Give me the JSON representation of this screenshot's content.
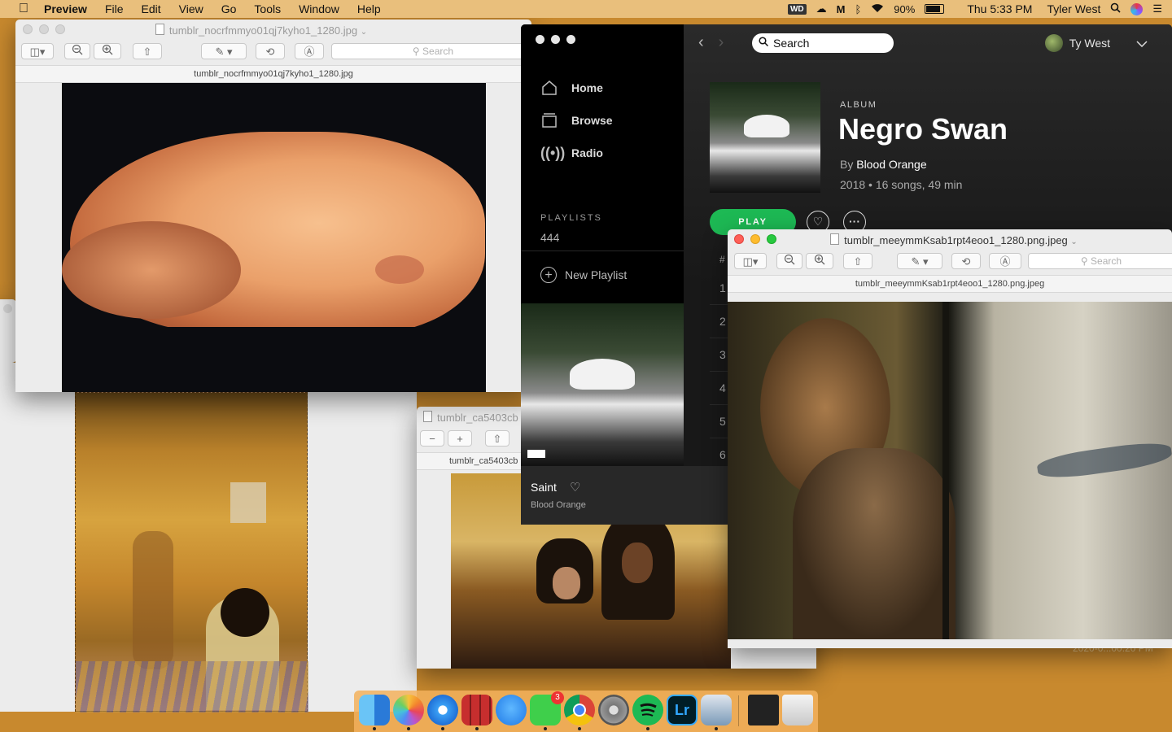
{
  "menubar": {
    "app": "Preview",
    "items": [
      "File",
      "Edit",
      "View",
      "Go",
      "Tools",
      "Window",
      "Help"
    ],
    "battery": "90%",
    "battery_level": 0.9,
    "clock": "Thu 5:33 PM",
    "user": "Tyler West",
    "status_icons": [
      "wd-icon",
      "creative-cloud-icon",
      "m-icon",
      "bluetooth-icon",
      "wifi-icon",
      "battery-icon",
      "search-icon",
      "siri-icon",
      "list-icon"
    ]
  },
  "preview1": {
    "title": "tumblr_nocrfmmyo01qj7kyho1_1280.jpg",
    "filename": "tumblr_nocrfmmyo01qj7kyho1_1280.jpg",
    "search_placeholder": "Search"
  },
  "preview2": {
    "title": "tumblr_ca5403cb",
    "filename": "tumblr_ca5403cb"
  },
  "preview3": {
    "title": "tumblr_meeymmKsab1rpt4eoo1_1280.png.jpeg",
    "filename": "tumblr_meeymmKsab1rpt4eoo1_1280.png.jpeg",
    "search_placeholder": "Search"
  },
  "spotify": {
    "nav": [
      {
        "label": "Home",
        "icon": "home-icon"
      },
      {
        "label": "Browse",
        "icon": "browse-icon"
      },
      {
        "label": "Radio",
        "icon": "radio-icon"
      }
    ],
    "playlists_title": "PLAYLISTS",
    "playlists_count": "444",
    "new_playlist": "New Playlist",
    "search_placeholder": "Search",
    "user_name": "Ty West",
    "album": {
      "kicker": "ALBUM",
      "title": "Negro Swan",
      "by_prefix": "By",
      "artist": "Blood Orange",
      "meta": "2018 • 16 songs, 49 min"
    },
    "play_label": "PLAY",
    "track_header": "#",
    "track_numbers": [
      "1",
      "2",
      "3",
      "4",
      "5",
      "6"
    ],
    "now_playing": {
      "title": "Saint",
      "artist": "Blood Orange"
    },
    "accent": "#1db954"
  },
  "desktop": {
    "background": "#c8892e",
    "partial_text": "2020-0...00.20 PM"
  },
  "dock": {
    "apps": [
      "finder-icon",
      "photos-icon",
      "safari-icon",
      "photo-booth-icon",
      "messages-icon",
      "facetime-icon",
      "chrome-icon",
      "system-preferences-icon",
      "spotify-icon",
      "lightroom-icon",
      "preview-icon",
      "screen-capture-icon",
      "trash-icon"
    ],
    "facetime_badge": "3",
    "lightroom_label": "Lr"
  }
}
